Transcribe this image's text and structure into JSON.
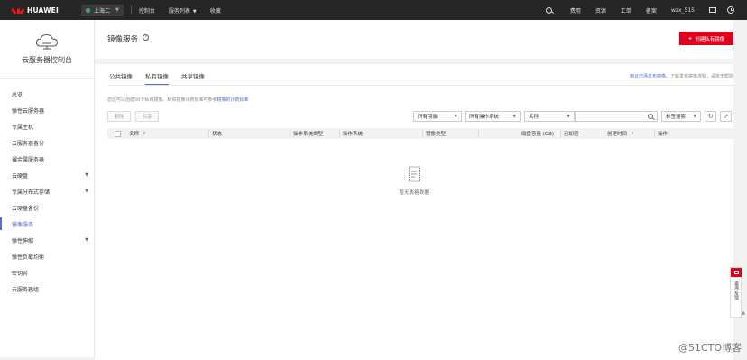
{
  "topbar": {
    "brand": "HUAWEI",
    "region": "上海二",
    "nav": [
      "控制台",
      "服务列表",
      "收藏"
    ],
    "right": [
      "费用",
      "资源",
      "工单",
      "备案",
      "wzx_515"
    ]
  },
  "sidebar": {
    "title": "云服务器控制台",
    "items": [
      {
        "label": "总览",
        "chevron": false
      },
      {
        "label": "弹性云服务器",
        "chevron": false
      },
      {
        "label": "专属主机",
        "chevron": false
      },
      {
        "label": "云服务器备份",
        "chevron": false
      },
      {
        "label": "裸金属服务器",
        "chevron": false
      },
      {
        "label": "云硬盘",
        "chevron": true
      },
      {
        "label": "专属分布式存储",
        "chevron": true
      },
      {
        "label": "云硬盘备份",
        "chevron": false
      },
      {
        "label": "镜像服务",
        "chevron": false,
        "active": true
      },
      {
        "label": "弹性伸缩",
        "chevron": true
      },
      {
        "label": "弹性负载均衡",
        "chevron": false
      },
      {
        "label": "密钥对",
        "chevron": false
      },
      {
        "label": "云服务器组",
        "chevron": false
      }
    ]
  },
  "page": {
    "title": "镜像服务",
    "create_label": "创建私有镜像"
  },
  "tabs": [
    "公共镜像",
    "私有镜像",
    "共享镜像"
  ],
  "active_tab": "私有镜像",
  "market_tip": {
    "link": "到云市场发布镜像。",
    "text": "了解发布镜像流程，请单击帮助"
  },
  "quota": {
    "text": "您还可以创建50个私有镜像。私有镜像计费标准可参考",
    "link": "镜像的计费标准"
  },
  "toolbar": {
    "delete_label": "删除",
    "share_label": "共享",
    "filter_image": "所有镜像",
    "filter_os": "所有操作系统",
    "filter_field": "名称",
    "search_placeholder": "",
    "tag_search": "标签搜索"
  },
  "table": {
    "columns": [
      "名称",
      "状态",
      "操作系统类型",
      "操作系统",
      "镜像类型",
      "磁盘容量 (GB)",
      "已加密",
      "创建时间",
      "操作"
    ]
  },
  "empty_text": "暂无表格数据",
  "float_panel": {
    "text": "咨询·反馈"
  },
  "watermark": "@51CTO博客",
  "colors": {
    "accent": "#526ecc",
    "brand_red": "#e1001b",
    "topbar_bg": "#262626"
  }
}
